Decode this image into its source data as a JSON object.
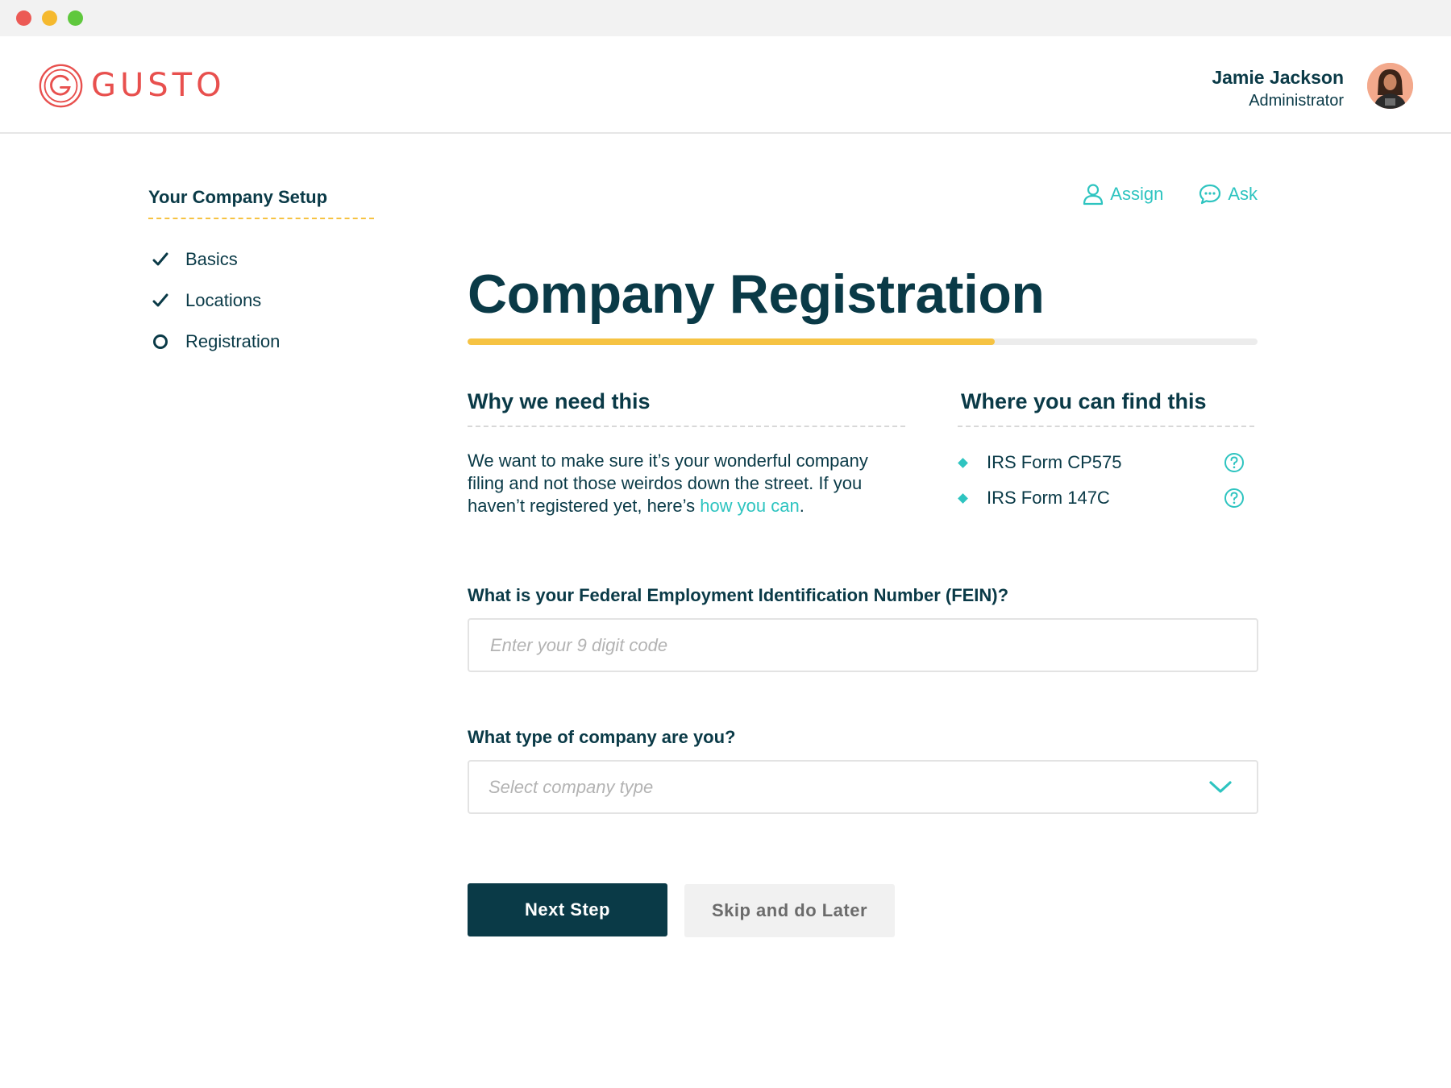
{
  "brand": {
    "name": "GUSTO",
    "color": "#e8504e",
    "icon": "gusto-logo-icon"
  },
  "user": {
    "name": "Jamie Jackson",
    "role": "Administrator",
    "avatar_icon": "user-avatar"
  },
  "sidebar": {
    "title": "Your Company Setup",
    "steps": [
      {
        "label": "Basics",
        "status": "complete",
        "icon": "check-icon"
      },
      {
        "label": "Locations",
        "status": "complete",
        "icon": "check-icon"
      },
      {
        "label": "Registration",
        "status": "current",
        "icon": "circle-icon"
      }
    ]
  },
  "actions": {
    "assign_label": "Assign",
    "ask_label": "Ask"
  },
  "page": {
    "title": "Company Registration",
    "progress": 0.667
  },
  "why": {
    "title": "Why we need this",
    "text": "We want to make sure it’s your wonderful company filing and not those weirdos down the street. If you haven’t registered yet, here’s ",
    "link": "how you can",
    "end": "."
  },
  "where": {
    "title": "Where you can find this",
    "items": [
      {
        "label": "IRS Form CP575",
        "icon": "help-icon"
      },
      {
        "label": "IRS Form 147C",
        "icon": "help-icon"
      }
    ]
  },
  "form": {
    "fein_label": "What is your Federal Employment Identification Number (FEIN)?",
    "fein_value": "",
    "fein_placeholder": "Enter your 9 digit code",
    "type_label": "What type of company are you?",
    "type_placeholder": "Select company type"
  },
  "buttons": {
    "next": "Next Step",
    "skip": "Skip and do Later"
  },
  "colors": {
    "navy": "#0a3a47",
    "teal": "#2ec4c0",
    "yellow": "#f6c343",
    "red": "#e8504e"
  }
}
